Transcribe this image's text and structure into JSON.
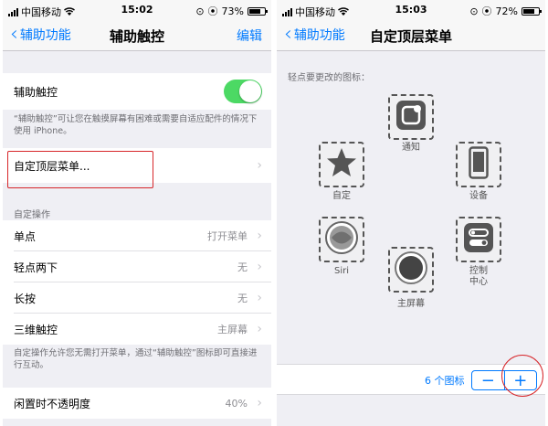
{
  "left": {
    "status": {
      "carrier": "中国移动",
      "time": "15:02",
      "battery": "73%",
      "battery_level": 0.73
    },
    "nav": {
      "back_label": "辅助功能",
      "title": "辅助触控",
      "edit_label": "编辑"
    },
    "assistive_touch": {
      "label": "辅助触控",
      "enabled": true
    },
    "description": "“辅助触控”可让您在触摸屏幕有困难或需要自适应配件的情况下使用 iPhone。",
    "top_menu_label": "自定顶层菜单...",
    "custom_actions_header": "自定操作",
    "actions": [
      {
        "label": "单点",
        "value": "打开菜单"
      },
      {
        "label": "轻点两下",
        "value": "无"
      },
      {
        "label": "长按",
        "value": "无"
      },
      {
        "label": "三维触控",
        "value": "主屏幕"
      }
    ],
    "actions_note": "自定操作允许您无需打开菜单，通过“辅助触控”图标即可直接进行互动。",
    "idle_opacity": {
      "label": "闲置时不透明度",
      "value": "40%"
    }
  },
  "right": {
    "status": {
      "carrier": "中国移动",
      "time": "15:03",
      "battery": "72%",
      "battery_level": 0.72
    },
    "nav": {
      "back_label": "辅助功能",
      "title": "自定顶层菜单"
    },
    "instruction": "轻点要更改的图标：",
    "icons": [
      {
        "icon": "notification-icon",
        "label": "通知"
      },
      {
        "icon": "star-icon",
        "label": "自定"
      },
      {
        "icon": "device-icon",
        "label": "设备"
      },
      {
        "icon": "siri-icon",
        "label": "Siri"
      },
      {
        "icon": "control-center-icon",
        "label": "控制\n中心"
      },
      {
        "icon": "home-icon",
        "label": "主屏幕"
      }
    ],
    "count_label": "6 个图标",
    "minus_label": "−",
    "plus_label": "+"
  },
  "colors": {
    "accent": "#007aff",
    "toggle_on": "#4cd964",
    "highlight": "#d7262a"
  }
}
